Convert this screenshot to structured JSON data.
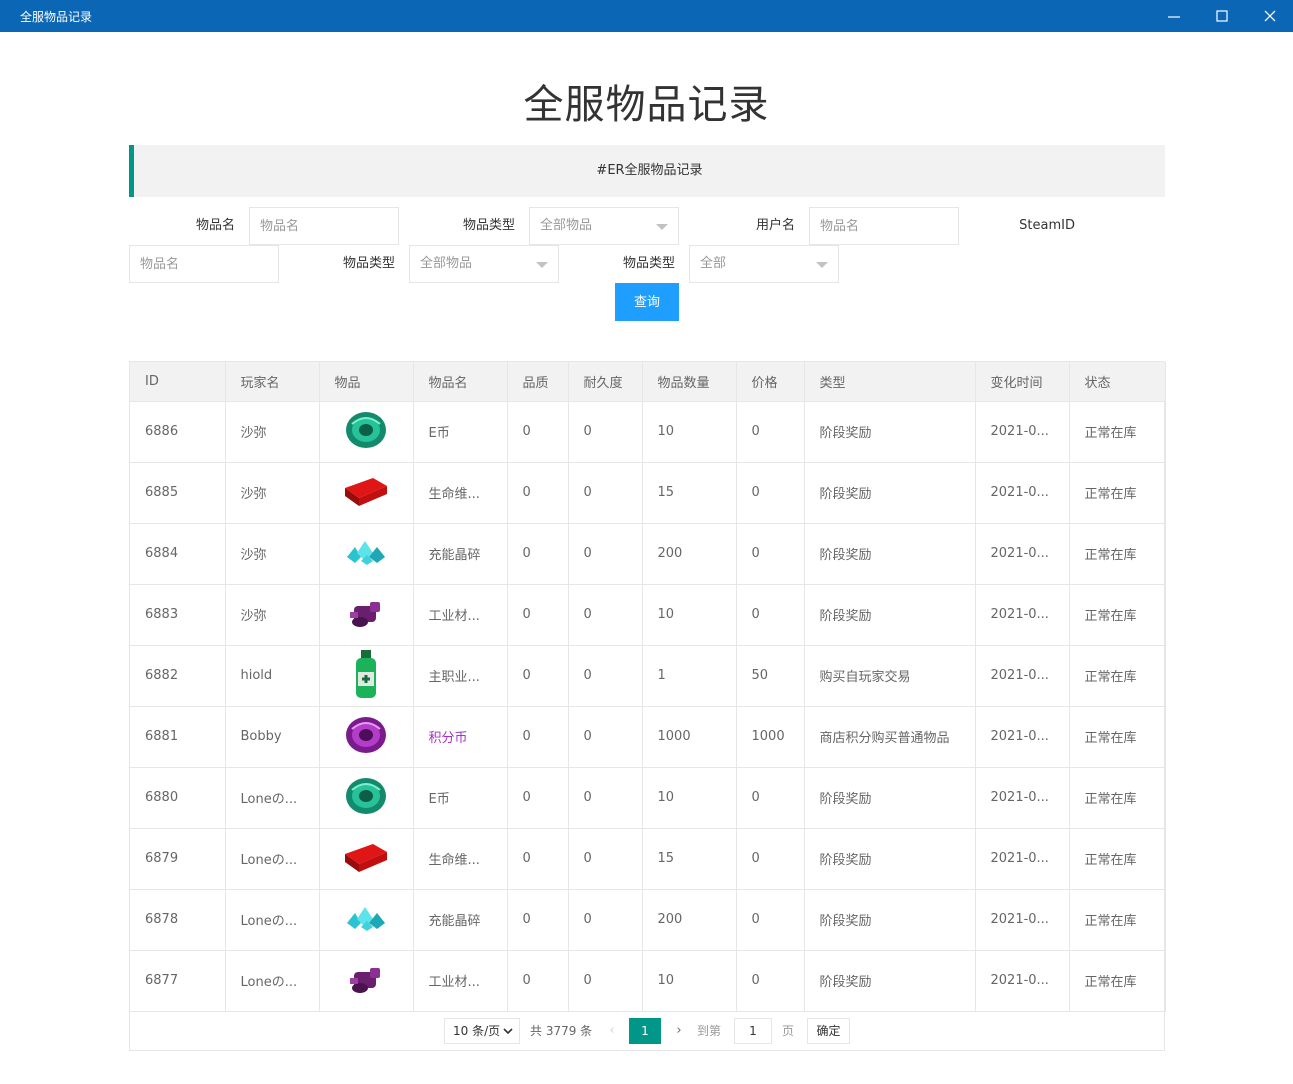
{
  "window": {
    "title": "全服物品记录",
    "minimize_icon": "minimize-icon",
    "maximize_icon": "maximize-icon",
    "close_icon": "close-icon"
  },
  "page": {
    "heading": "全服物品记录",
    "notice": "#ER全服物品记录"
  },
  "filters": {
    "item_name_label": "物品名",
    "item_name_placeholder": "物品名",
    "item_type_label": "物品类型",
    "item_type_value": "全部物品",
    "username_label": "用户名",
    "username_placeholder": "物品名",
    "steamid_label": "SteamID",
    "steamid_placeholder": "物品名",
    "item_type2_label": "物品类型",
    "item_type2_value": "全部物品",
    "item_type3_label": "物品类型",
    "item_type3_value": "全部",
    "query_button": "查询"
  },
  "table": {
    "columns": [
      "ID",
      "玩家名",
      "物品",
      "物品名",
      "品质",
      "耐久度",
      "物品数量",
      "价格",
      "类型",
      "变化时间",
      "状态"
    ],
    "rows": [
      {
        "id": "6886",
        "player": "沙弥",
        "icon": "green-coin-icon",
        "name": "E币",
        "quality": "0",
        "durability": "0",
        "count": "10",
        "price": "0",
        "type": "阶段奖励",
        "time": "2021-0...",
        "status": "正常在库"
      },
      {
        "id": "6885",
        "player": "沙弥",
        "icon": "red-box-icon",
        "name": "生命维...",
        "quality": "0",
        "durability": "0",
        "count": "15",
        "price": "0",
        "type": "阶段奖励",
        "time": "2021-0...",
        "status": "正常在库"
      },
      {
        "id": "6884",
        "player": "沙弥",
        "icon": "crystal-shards-icon",
        "name": "充能晶碎",
        "quality": "0",
        "durability": "0",
        "count": "200",
        "price": "0",
        "type": "阶段奖励",
        "time": "2021-0...",
        "status": "正常在库"
      },
      {
        "id": "6883",
        "player": "沙弥",
        "icon": "industrial-material-icon",
        "name": "工业材...",
        "quality": "0",
        "durability": "0",
        "count": "10",
        "price": "0",
        "type": "阶段奖励",
        "time": "2021-0...",
        "status": "正常在库"
      },
      {
        "id": "6882",
        "player": "hiold",
        "icon": "green-bottle-icon",
        "name": "主职业...",
        "quality": "0",
        "durability": "0",
        "count": "1",
        "price": "50",
        "type": "购买自玩家交易",
        "time": "2021-0...",
        "status": "正常在库"
      },
      {
        "id": "6881",
        "player": "Bobby",
        "icon": "purple-coin-icon",
        "name": "积分币",
        "name_color": "#a233c6",
        "quality": "0",
        "durability": "0",
        "count": "1000",
        "price": "1000",
        "type": "商店积分购买普通物品",
        "time": "2021-0...",
        "status": "正常在库"
      },
      {
        "id": "6880",
        "player": "Loneの...",
        "icon": "green-coin-icon",
        "name": "E币",
        "quality": "0",
        "durability": "0",
        "count": "10",
        "price": "0",
        "type": "阶段奖励",
        "time": "2021-0...",
        "status": "正常在库"
      },
      {
        "id": "6879",
        "player": "Loneの...",
        "icon": "red-box-icon",
        "name": "生命维...",
        "quality": "0",
        "durability": "0",
        "count": "15",
        "price": "0",
        "type": "阶段奖励",
        "time": "2021-0...",
        "status": "正常在库"
      },
      {
        "id": "6878",
        "player": "Loneの...",
        "icon": "crystal-shards-icon",
        "name": "充能晶碎",
        "quality": "0",
        "durability": "0",
        "count": "200",
        "price": "0",
        "type": "阶段奖励",
        "time": "2021-0...",
        "status": "正常在库"
      },
      {
        "id": "6877",
        "player": "Loneの...",
        "icon": "industrial-material-icon",
        "name": "工业材...",
        "quality": "0",
        "durability": "0",
        "count": "10",
        "price": "0",
        "type": "阶段奖励",
        "time": "2021-0...",
        "status": "正常在库"
      }
    ]
  },
  "pagination": {
    "page_size": "10 条/页",
    "total": "共 3779 条",
    "current_page": "1",
    "goto_label": "到第",
    "goto_value": "1",
    "page_suffix": "页",
    "confirm": "确定"
  }
}
